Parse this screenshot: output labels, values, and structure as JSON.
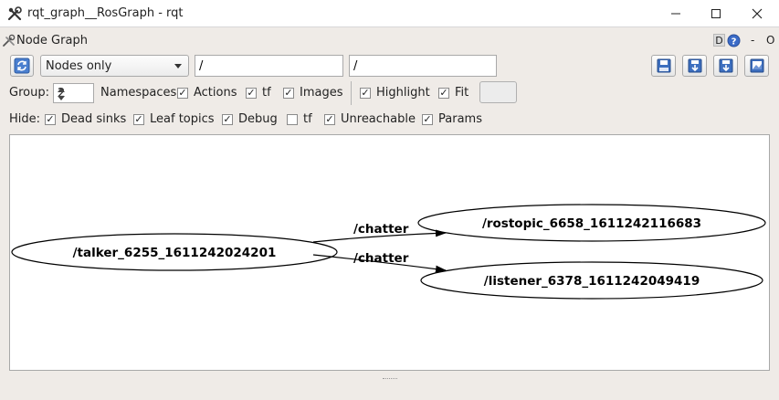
{
  "window": {
    "title": "rqt_graph__RosGraph - rqt"
  },
  "dock": {
    "title": "Node Graph",
    "d_label": "D",
    "dash_label": "-",
    "o_label": "O"
  },
  "toolbar": {
    "mode_selected": "Nodes only",
    "filter1_value": "/",
    "filter2_value": "/"
  },
  "options": {
    "group_label": "Group:",
    "group_value": "2",
    "namespaces_label": "Namespaces",
    "actions_label": "Actions",
    "tf_label": "tf",
    "images_label": "Images",
    "highlight_label": "Highlight",
    "fit_label": "Fit"
  },
  "hide": {
    "label": "Hide:",
    "dead_sinks": "Dead sinks",
    "leaf_topics": "Leaf topics",
    "debug": "Debug",
    "tf": "tf",
    "unreachable": "Unreachable",
    "params": "Params"
  },
  "checks": {
    "namespaces": true,
    "actions": true,
    "tf": true,
    "highlight": true,
    "fit": true,
    "dead_sinks": true,
    "leaf_topics": true,
    "debug": true,
    "hide_tf": false,
    "unreachable": true,
    "params": true
  },
  "graph": {
    "nodes": {
      "talker": "/talker_6255_1611242024201",
      "rostopic": "/rostopic_6658_1611242116683",
      "listener": "/listener_6378_1611242049419"
    },
    "edges": {
      "edge1": "/chatter",
      "edge2": "/chatter"
    }
  }
}
